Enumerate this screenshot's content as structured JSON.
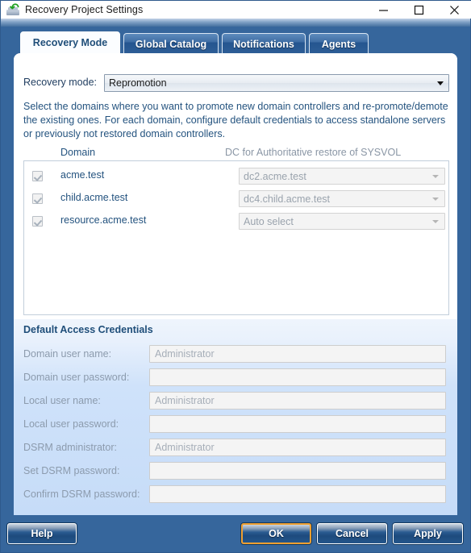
{
  "window": {
    "title": "Recovery Project Settings",
    "icon": "recovery-project-icon",
    "frame_color": "#36669c"
  },
  "titlebar_buttons": {
    "minimize": "minimize-icon",
    "maximize": "maximize-icon",
    "close": "close-icon"
  },
  "tabs": [
    {
      "label": "Recovery Mode",
      "active": true
    },
    {
      "label": "Global Catalog",
      "active": false
    },
    {
      "label": "Notifications",
      "active": false
    },
    {
      "label": "Agents",
      "active": false
    }
  ],
  "recovery_mode": {
    "label": "Recovery mode:",
    "value": "Repromotion"
  },
  "description": "Select the domains where you want to promote new domain controllers and re-promote/demote the existing ones. For each domain, configure default credentials to access standalone servers or previously not restored domain controllers.",
  "domain_table": {
    "header_domain": "Domain",
    "header_dc": "DC for Authoritative restore of SYSVOL",
    "rows": [
      {
        "checked": true,
        "domain": "acme.test",
        "dc": "dc2.acme.test"
      },
      {
        "checked": true,
        "domain": "child.acme.test",
        "dc": "dc4.child.acme.test"
      },
      {
        "checked": true,
        "domain": "resource.acme.test",
        "dc": "Auto select"
      }
    ]
  },
  "credentials": {
    "title": "Default Access Credentials",
    "fields": [
      {
        "label": "Domain user name:",
        "value": "Administrator"
      },
      {
        "label": "Domain user password:",
        "value": ""
      },
      {
        "label": "Local user name:",
        "value": "Administrator"
      },
      {
        "label": "Local user password:",
        "value": ""
      },
      {
        "label": "DSRM administrator:",
        "value": "Administrator"
      },
      {
        "label": "Set DSRM password:",
        "value": ""
      },
      {
        "label": "Confirm DSRM password:",
        "value": ""
      }
    ]
  },
  "buttons": {
    "help": "Help",
    "ok": "OK",
    "cancel": "Cancel",
    "apply": "Apply"
  }
}
